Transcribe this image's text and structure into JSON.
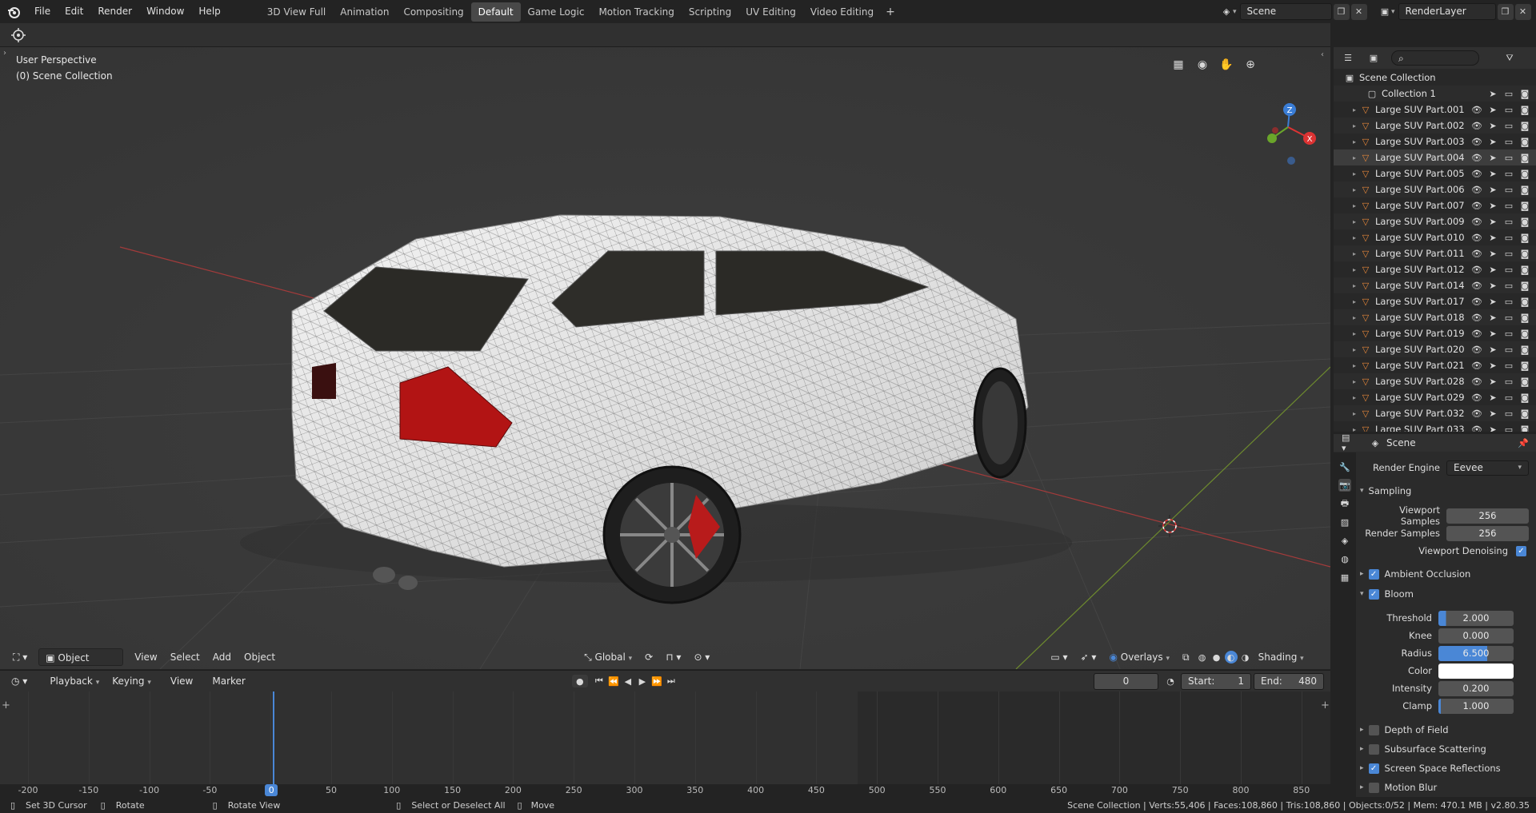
{
  "menu": [
    "File",
    "Edit",
    "Render",
    "Window",
    "Help"
  ],
  "workspaces": [
    "3D View Full",
    "Animation",
    "Compositing",
    "Default",
    "Game Logic",
    "Motion Tracking",
    "Scripting",
    "UV Editing",
    "Video Editing"
  ],
  "active_workspace": "Default",
  "scene_name": "Scene",
  "view_layer": "RenderLayer",
  "viewport": {
    "perspective_label": "User Perspective",
    "collection_label": "(0) Scene Collection",
    "mode": "Object Mode",
    "menu": [
      "View",
      "Select",
      "Add",
      "Object"
    ],
    "transform_orientation": "Global",
    "overlays_label": "Overlays",
    "shading_label": "Shading",
    "gizmo_labels": {
      "z": "Z",
      "x": "X",
      "y": "Y"
    }
  },
  "timeline": {
    "menu": [
      "Playback",
      "Keying",
      "View",
      "Marker"
    ],
    "current_frame": "0",
    "start_label": "Start:",
    "start": "1",
    "end_label": "End:",
    "end": "480",
    "ruler": [
      "-200",
      "-150",
      "-100",
      "-50",
      "0",
      "50",
      "100",
      "150",
      "200",
      "250",
      "300",
      "350",
      "400",
      "450",
      "500",
      "550",
      "600",
      "650",
      "700",
      "750",
      "800",
      "850"
    ],
    "playhead_frame": 0
  },
  "outliner": {
    "root": "Scene Collection",
    "collection": "Collection 1",
    "items": [
      "Large SUV Part.001",
      "Large SUV Part.002",
      "Large SUV Part.003",
      "Large SUV Part.004",
      "Large SUV Part.005",
      "Large SUV Part.006",
      "Large SUV Part.007",
      "Large SUV Part.009",
      "Large SUV Part.010",
      "Large SUV Part.011",
      "Large SUV Part.012",
      "Large SUV Part.014",
      "Large SUV Part.017",
      "Large SUV Part.018",
      "Large SUV Part.019",
      "Large SUV Part.020",
      "Large SUV Part.021",
      "Large SUV Part.028",
      "Large SUV Part.029",
      "Large SUV Part.032",
      "Large SUV Part.033"
    ],
    "selected": "Large SUV Part.004"
  },
  "properties": {
    "context": "Scene",
    "render_engine_label": "Render Engine",
    "render_engine": "Eevee",
    "sampling": {
      "title": "Sampling",
      "viewport_samples_label": "Viewport Samples",
      "viewport_samples": "256",
      "render_samples_label": "Render Samples",
      "render_samples": "256",
      "viewport_denoising_label": "Viewport Denoising",
      "viewport_denoising": true
    },
    "ambient_occlusion": {
      "label": "Ambient Occlusion",
      "enabled": true
    },
    "bloom": {
      "label": "Bloom",
      "enabled": true,
      "threshold_label": "Threshold",
      "threshold": "2.000",
      "threshold_fill": 0.1,
      "knee_label": "Knee",
      "knee": "0.000",
      "knee_fill": 0.0,
      "radius_label": "Radius",
      "radius": "6.500",
      "radius_fill": 0.65,
      "color_label": "Color",
      "color": "#ffffff",
      "intensity_label": "Intensity",
      "intensity": "0.200",
      "intensity_fill": 0.0,
      "clamp_label": "Clamp",
      "clamp": "1.000",
      "clamp_fill": 0.03
    },
    "panels": [
      {
        "label": "Depth of Field",
        "enabled": false
      },
      {
        "label": "Subsurface Scattering",
        "enabled": false
      },
      {
        "label": "Screen Space Reflections",
        "enabled": true
      },
      {
        "label": "Motion Blur",
        "enabled": false
      }
    ]
  },
  "status": {
    "set_cursor": "Set 3D Cursor",
    "rotate": "Rotate",
    "rotate_view": "Rotate View",
    "select_all": "Select or Deselect All",
    "move": "Move",
    "stats": "Scene Collection | Verts:55,406 | Faces:108,860 | Tris:108,860 | Objects:0/52 | Mem: 470.1 MB | v2.80.35"
  },
  "colors": {
    "accent": "#4a87d6",
    "object_orange": "#e8883a",
    "selection_bg": "#3d3d3d"
  }
}
